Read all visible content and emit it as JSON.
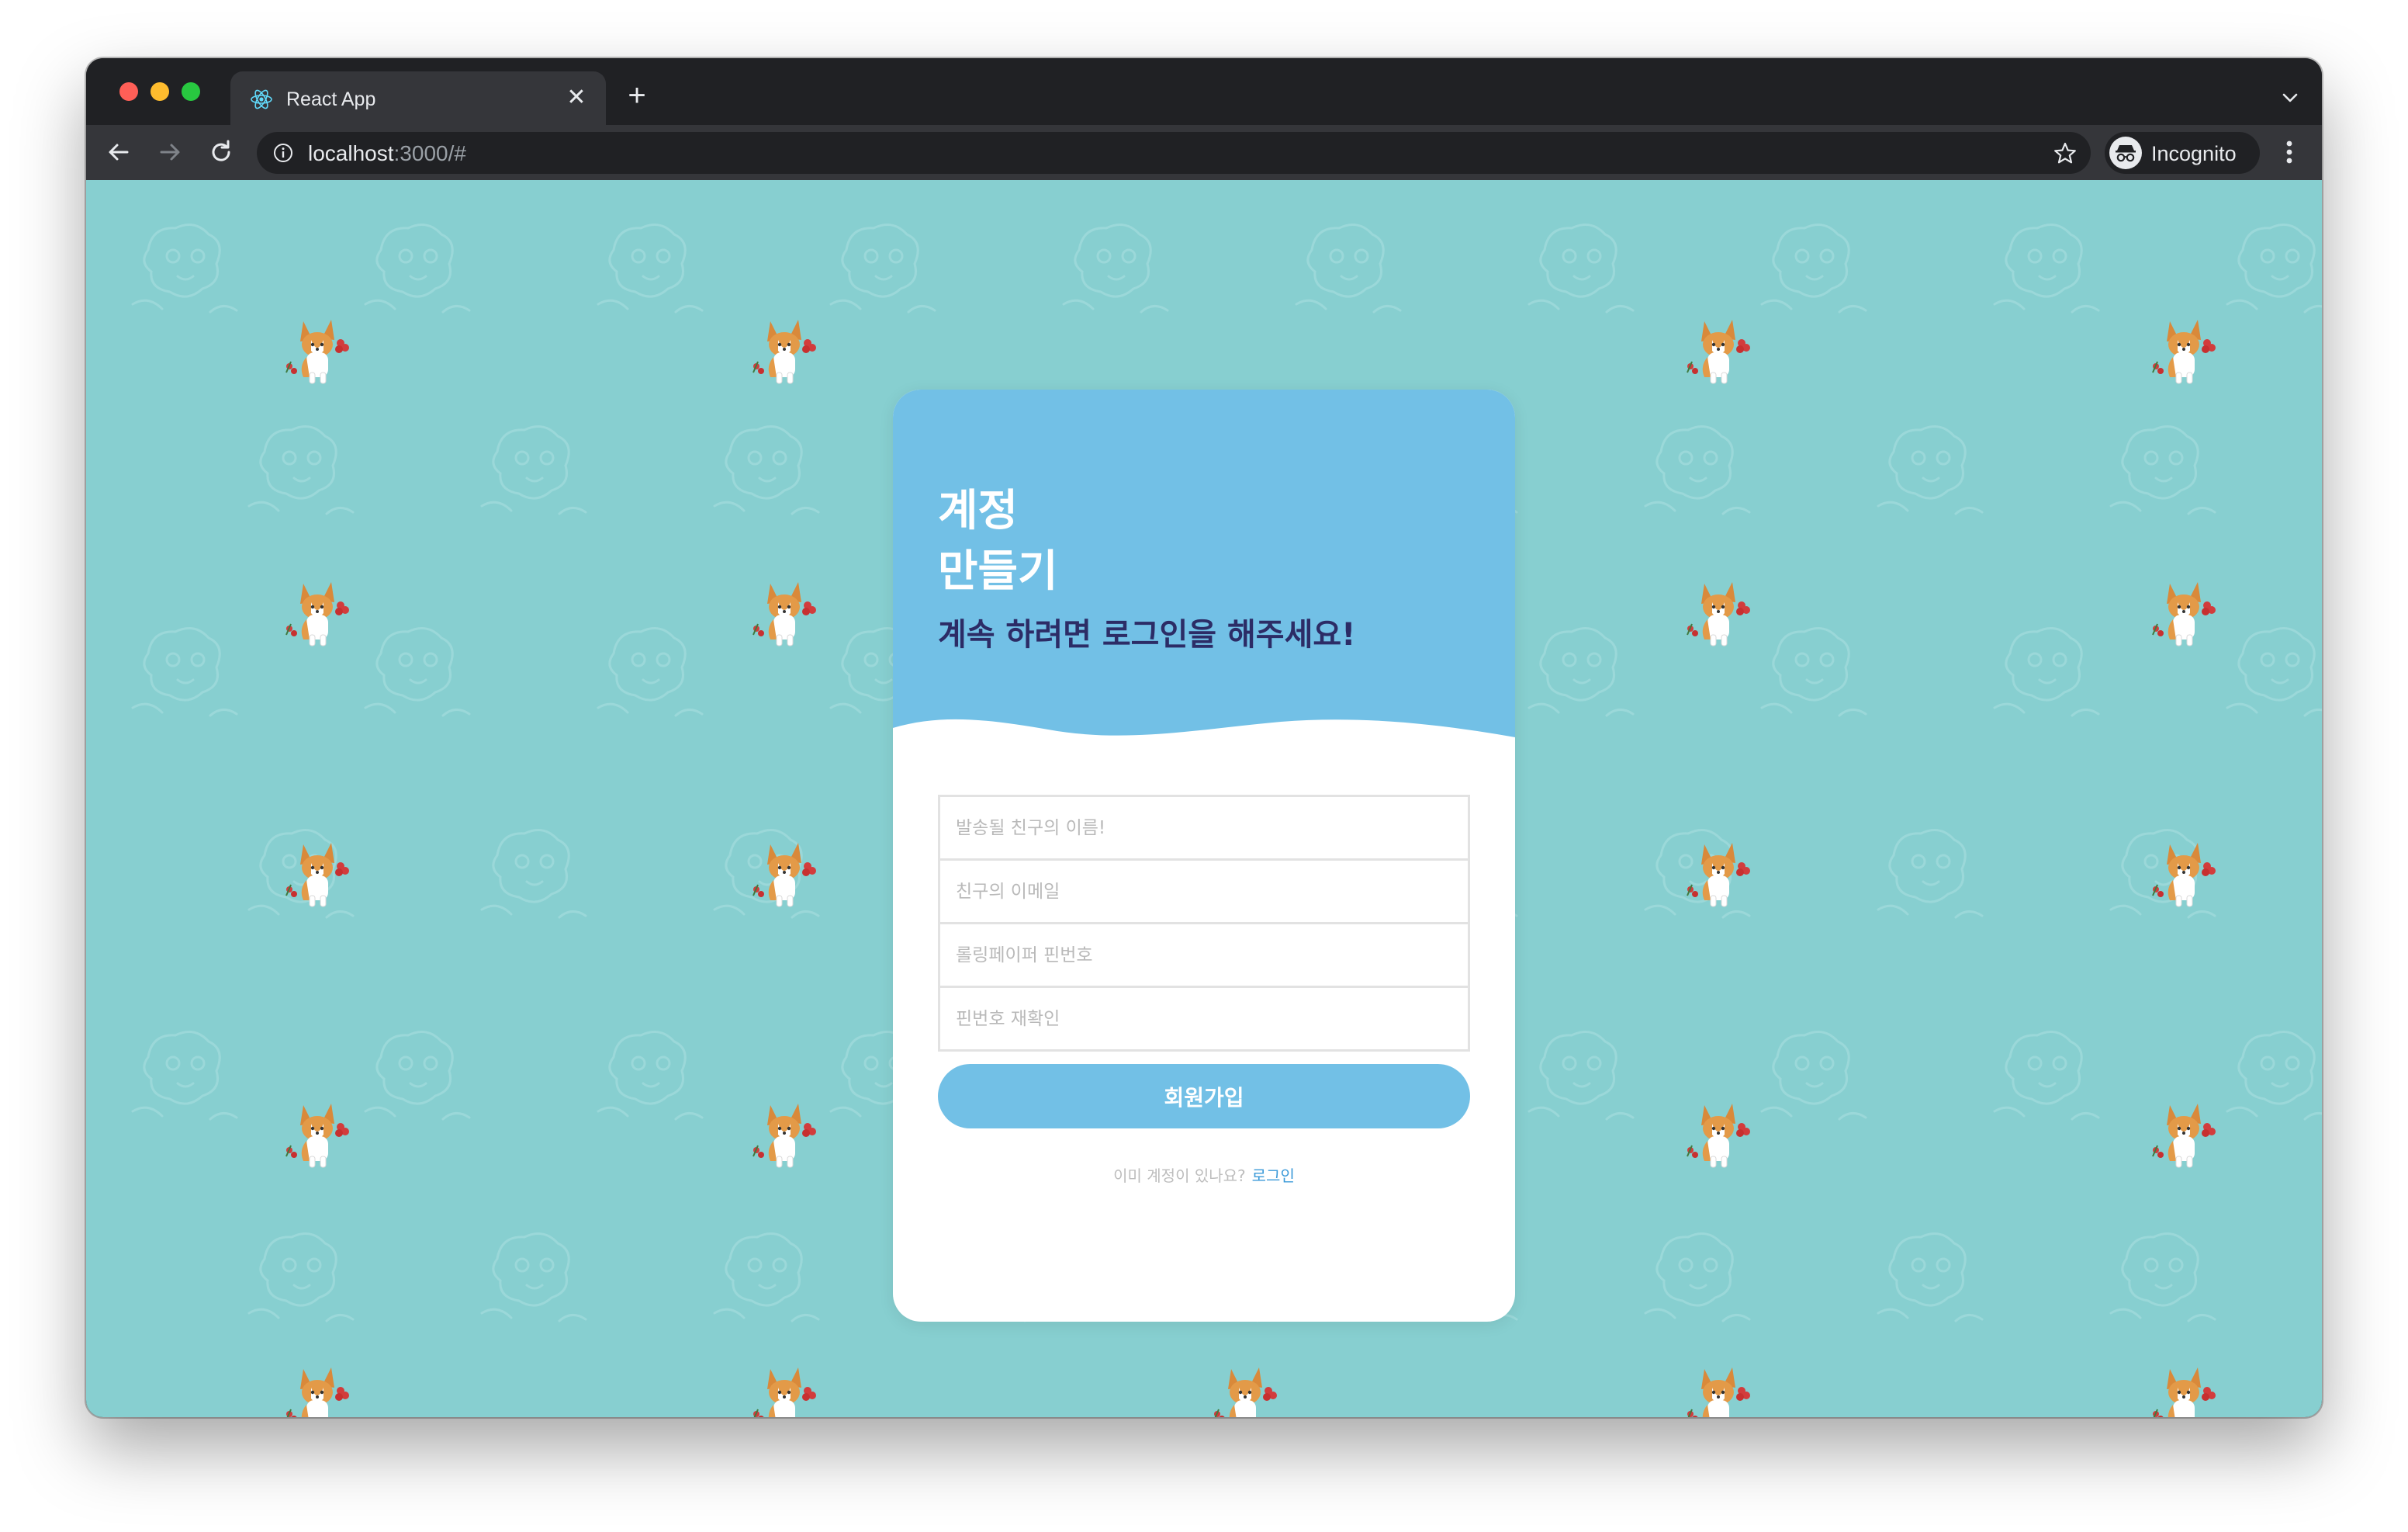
{
  "browser": {
    "tab_title": "React App",
    "url_host": "localhost",
    "url_path": ":3000/#",
    "profile_label": "Incognito",
    "icons": [
      "react-favicon-icon",
      "close-icon",
      "plus-icon",
      "chevron-down-icon",
      "back-arrow-icon",
      "forward-arrow-icon",
      "reload-icon",
      "info-icon",
      "star-icon",
      "incognito-icon",
      "kebab-menu-icon"
    ]
  },
  "page": {
    "background_color": "#87cfd0",
    "background_pattern": [
      "corgi-sticker-icon",
      "faint-doodle-icon"
    ]
  },
  "signup": {
    "title_line1": "계정",
    "title_line2": "만들기",
    "subtitle": "계속 하려면 로그인을 해주세요!",
    "header_color": "#72c0e6",
    "fields": {
      "name_placeholder": "발송될 친구의 이름!",
      "email_placeholder": "친구의 이메일",
      "pin_placeholder": "롤링페이퍼 핀번호",
      "pin_confirm_placeholder": "핀번호 재확인"
    },
    "submit_label": "회원가입",
    "login_prompt": "이미 계정이 있나요?",
    "login_link": "로그인"
  }
}
